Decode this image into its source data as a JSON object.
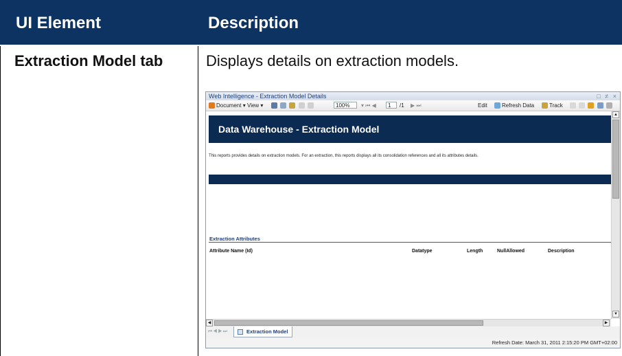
{
  "table": {
    "header": {
      "col1": "UI Element",
      "col2": "Description"
    },
    "row": {
      "element": "Extraction Model tab",
      "description": "Displays details on extraction models."
    }
  },
  "screenshot": {
    "window_title": "Web Intelligence - Extraction Model Details",
    "window_controls": "□ ≠ ×",
    "toolbar": {
      "document": "Document",
      "view": "View",
      "zoom": "100%",
      "page": "1",
      "page_total": "/1",
      "edit": "Edit",
      "refresh": "Refresh Data",
      "track": "Track"
    },
    "report": {
      "title": "Data Warehouse - Extraction Model",
      "intro": "This reports provides details on extraction models. For an extraction, this reports displays all its consolidation references and all its attributes details.",
      "section_title": "Extraction Attributes",
      "columns": [
        "Attribute Name (Id)",
        "Datatype",
        "Length",
        "NullAllowed",
        "Description"
      ]
    },
    "tab_label": "Extraction Model",
    "status": "Refresh Date: March 31, 2011 2:15:20 PM GMT+02:00",
    "colors": {
      "header_bg": "#0d3362",
      "banner_bg": "#0b2b52",
      "accent": "#1f3f7a"
    }
  }
}
